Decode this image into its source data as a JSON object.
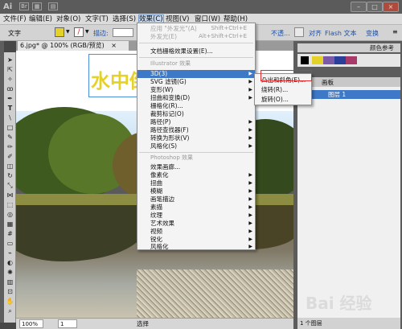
{
  "titlebar": {
    "app_logo": "Ai",
    "icon": "Br"
  },
  "menu": [
    "文件(F)",
    "编辑(E)",
    "对象(O)",
    "文字(T)",
    "选择(S)",
    "效果(C)",
    "视图(V)",
    "窗口(W)",
    "帮助(H)"
  ],
  "control_bar": {
    "mode_label": "文字",
    "stroke_label": "描边:",
    "opacity_label": "不透...",
    "align_label": "对齐",
    "flash_label": "Flash 文本",
    "transform_label": "变换"
  },
  "document_tab": {
    "title": "6.jpg* @ 100% (RGB/预览)",
    "close": "×"
  },
  "canvas": {
    "text": "水中倒影"
  },
  "status_bar": {
    "zoom": "100%",
    "page": "1",
    "status": "选择"
  },
  "right_panel": {
    "color_tab": "颜色参考",
    "layers_title": "图层",
    "layers_tab2": "画板",
    "layer_name": "图层 1",
    "layer_count": "1 个图层"
  },
  "effect_menu": {
    "apply_last": {
      "label": "应用 \"外发光\"(A)",
      "shortcut": "Shift+Ctrl+E"
    },
    "last_effect": {
      "label": "外发光(E)",
      "shortcut": "Alt+Shift+Ctrl+E"
    },
    "doc_raster": "文档栅格效果设置(E)...",
    "illustrator_header": "Illustrator 效果",
    "illustrator_items": [
      "3D(3)",
      "SVG 滤镜(G)",
      "变形(W)",
      "扭曲和变换(D)",
      "栅格化(R)...",
      "裁剪标记(O)",
      "路径(P)",
      "路径查找器(F)",
      "转换为形状(V)",
      "风格化(S)"
    ],
    "photoshop_header": "Photoshop 效果",
    "photoshop_items": [
      "效果画廊...",
      "像素化",
      "扭曲",
      "模糊",
      "画笔描边",
      "素描",
      "纹理",
      "艺术效果",
      "视频",
      "锐化",
      "风格化"
    ]
  },
  "submenu_3d": [
    "凸出和斜角(E)...",
    "绕转(R)...",
    "旋转(O)..."
  ],
  "watermark": "Bai 经验",
  "colors": {
    "highlight": "#3d79c7",
    "red_box": "#e52a2a",
    "text_yellow": "#e5d229"
  }
}
